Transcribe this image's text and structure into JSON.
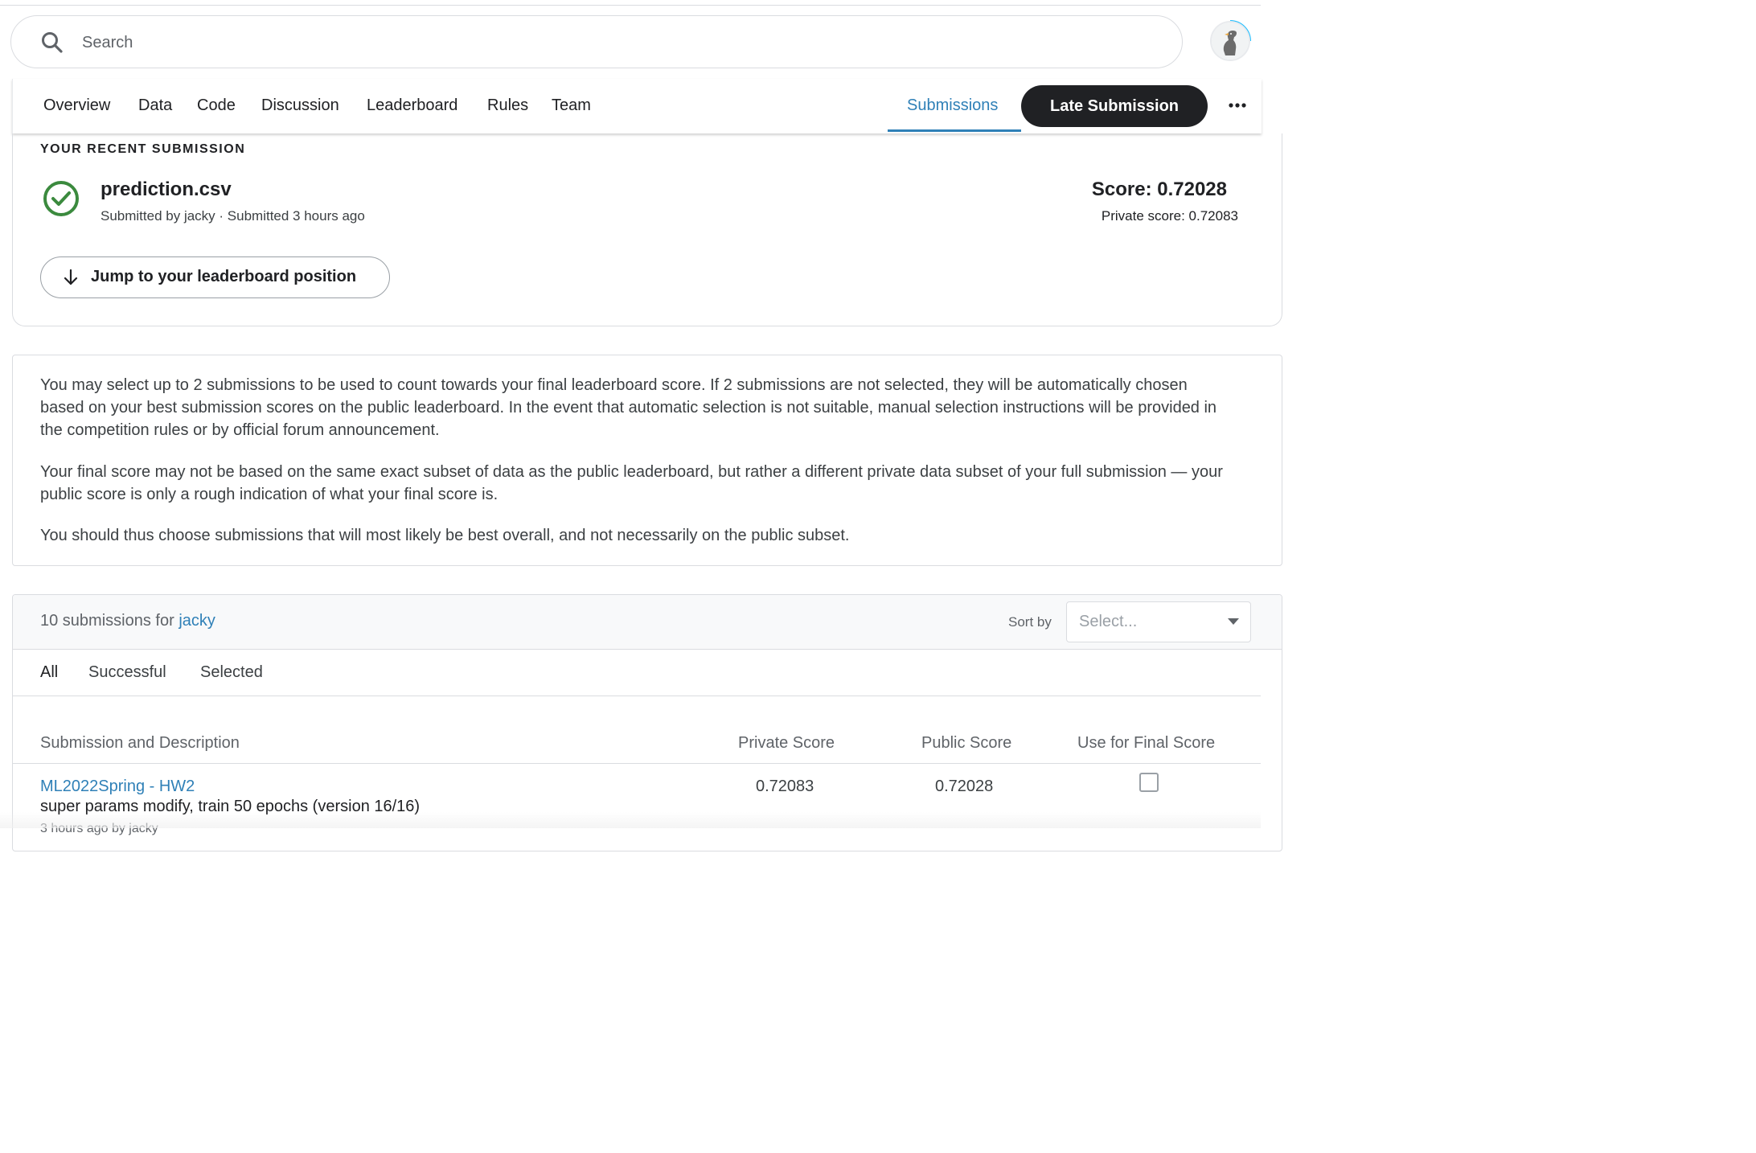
{
  "search": {
    "placeholder": "Search"
  },
  "nav": {
    "items": [
      {
        "label": "Overview"
      },
      {
        "label": "Data"
      },
      {
        "label": "Code"
      },
      {
        "label": "Discussion"
      },
      {
        "label": "Leaderboard"
      },
      {
        "label": "Rules"
      },
      {
        "label": "Team"
      }
    ],
    "submissions_label": "Submissions",
    "late_submission_label": "Late Submission",
    "more_icon": "more-horizontal-icon"
  },
  "recent": {
    "heading": "YOUR RECENT SUBMISSION",
    "file_name": "prediction.csv",
    "submitted_by": "Submitted by jacky · Submitted 3 hours ago",
    "score": "Score: 0.72028",
    "private_score": "Private score: 0.72083",
    "jump_label": "Jump to your leaderboard position",
    "status_icon": "check-circle-icon",
    "status_color": "#3b8a3e"
  },
  "info": {
    "p1": "You may select up to 2 submissions to be used to count towards your final leaderboard score. If 2 submissions are not selected, they will be automatically chosen based on your best submission scores on the public leaderboard. In the event that automatic selection is not suitable, manual selection instructions will be provided in the competition rules or by official forum announcement.",
    "p2": "Your final score may not be based on the same exact subset of data as the public leaderboard, but rather a different private data subset of your full submission — your public score is only a rough indication of what your final score is.",
    "p3": "You should thus choose submissions that will most likely be best overall, and not necessarily on the public subset."
  },
  "submissions": {
    "count_text": "10 submissions for",
    "user": "jacky",
    "sort_label": "Sort by",
    "sort_placeholder": "Select...",
    "tabs": [
      {
        "label": "All"
      },
      {
        "label": "Successful"
      },
      {
        "label": "Selected"
      }
    ],
    "columns": {
      "description": "Submission and Description",
      "private": "Private Score",
      "public": "Public Score",
      "final": "Use for Final Score"
    },
    "rows": [
      {
        "title": "ML2022Spring - HW2",
        "description": "super params modify, train 50 epochs (version 16/16)",
        "meta": "3 hours ago by jacky",
        "private_score": "0.72083",
        "public_score": "0.72028",
        "selected": false
      }
    ]
  },
  "colors": {
    "accent": "#2f80b7",
    "dark_button": "#202124",
    "border": "#dadce0"
  }
}
